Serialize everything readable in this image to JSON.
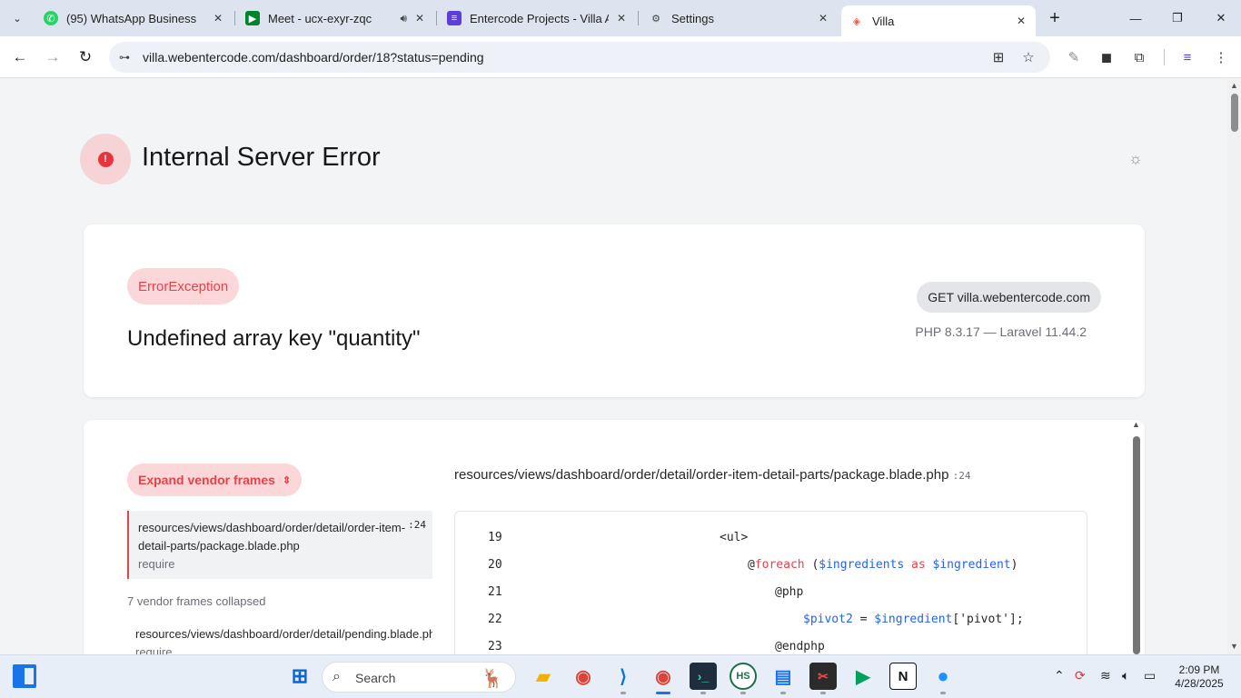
{
  "browser": {
    "tabs": [
      {
        "title": "(95) WhatsApp Business",
        "icon": "whatsapp-icon"
      },
      {
        "title": "Meet - ucx-exyr-zqc",
        "icon": "google-meet-icon"
      },
      {
        "title": "Entercode Projects - Villa Ap",
        "icon": "entercode-icon"
      },
      {
        "title": "Settings",
        "icon": "settings-icon"
      },
      {
        "title": "Villa",
        "icon": "laravel-icon",
        "active": true
      }
    ],
    "url": "villa.webentercode.com/dashboard/order/18?status=pending"
  },
  "page": {
    "title": "Internal Server Error",
    "exception_type": "ErrorException",
    "exception_message": "Undefined array key \"quantity\"",
    "request": "GET villa.webentercode.com",
    "versions": "PHP 8.3.17 — Laravel 11.44.2",
    "expand_label": "Expand vendor frames",
    "active_frame": {
      "path": "resources/views/dashboard/order/detail/order-item-detail-parts/package.blade.php",
      "line": ":24",
      "function": "require"
    },
    "vendor_collapsed": "7 vendor frames collapsed",
    "second_frame": {
      "path": "resources/views/dashboard/order/detail/pending.blade.php",
      "function": "require"
    },
    "file_header": {
      "path": "resources/views/dashboard/order/detail/order-item-detail-parts/package.blade.php",
      "line": ":24"
    },
    "code_lines": [
      {
        "num": "19"
      },
      {
        "num": "20"
      },
      {
        "num": "21"
      },
      {
        "num": "22"
      },
      {
        "num": "23"
      }
    ],
    "code": {
      "l19": "<ul>",
      "l20_at": "@",
      "l20_kw": "foreach",
      "l20_open": " (",
      "l20_var1": "$ingredients",
      "l20_as": " as ",
      "l20_var2": "$ingredient",
      "l20_close": ")",
      "l21": "@php",
      "l22_var1": "$pivot2",
      "l22_eq": " = ",
      "l22_var2": "$ingredient",
      "l22_rest": "['pivot'];",
      "l23": "@endphp"
    }
  },
  "taskbar": {
    "search_placeholder": "Search",
    "time": "2:09 PM",
    "date": "4/28/2025"
  },
  "colors": {
    "error_red": "#e5424a",
    "error_pill_bg": "#fcd7d9",
    "code_blue": "#2563eb"
  }
}
